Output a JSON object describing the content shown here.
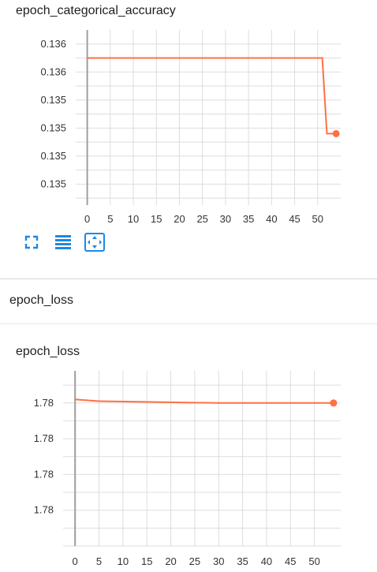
{
  "charts": [
    {
      "title": "epoch_categorical_accuracy"
    },
    {
      "title": "epoch_loss"
    }
  ],
  "section": {
    "title": "epoch_loss"
  },
  "toolbar": {
    "buttons": [
      {
        "icon": "expand-icon"
      },
      {
        "icon": "data-table-icon"
      },
      {
        "icon": "fit-domain-icon"
      }
    ]
  },
  "colors": {
    "series": "#ff7043",
    "accent": "#1e88e5",
    "grid": "#dddddd",
    "axis": "#9e9e9e"
  },
  "chart_data": [
    {
      "type": "line",
      "title": "epoch_categorical_accuracy",
      "x": [
        0,
        51,
        52,
        54
      ],
      "y": [
        0.13617,
        0.13617,
        0.13563,
        0.13563
      ],
      "series": [
        {
          "color": "#ff7043"
        }
      ],
      "xticks": [
        0,
        5,
        10,
        15,
        20,
        25,
        30,
        35,
        40,
        45,
        50
      ],
      "xlim": [
        -2.5,
        55
      ],
      "yticks": [
        0.13627,
        0.13617,
        0.13607,
        0.13597,
        0.13587,
        0.13577,
        0.13567,
        0.13557,
        0.13547,
        0.13537,
        0.13527,
        0.13517
      ],
      "ytick_labels": [
        "0.136",
        "",
        "0.136",
        "",
        "0.135",
        "",
        "0.135",
        "",
        "0.135",
        "",
        "0.135",
        ""
      ],
      "ylim": [
        0.13512,
        0.13637
      ],
      "grid": true
    },
    {
      "type": "line",
      "title": "epoch_loss",
      "x": [
        0,
        5,
        30,
        54
      ],
      "y": [
        1.7825,
        1.78245,
        1.7824,
        1.7824
      ],
      "series": [
        {
          "color": "#ff7043"
        }
      ],
      "xticks": [
        0,
        5,
        10,
        15,
        20,
        25,
        30,
        35,
        40,
        45,
        50
      ],
      "xlim": [
        -2.5,
        55.5
      ],
      "yticks": [
        1.7829,
        1.7824,
        1.7819,
        1.7814,
        1.7809,
        1.7804,
        1.7799,
        1.7794,
        1.7789,
        1.7784
      ],
      "ytick_labels": [
        "",
        "1.78",
        "",
        "1.78",
        "",
        "1.78",
        "",
        "1.78",
        "",
        ""
      ],
      "ylim": [
        1.7784,
        1.7833
      ],
      "grid": true
    }
  ]
}
